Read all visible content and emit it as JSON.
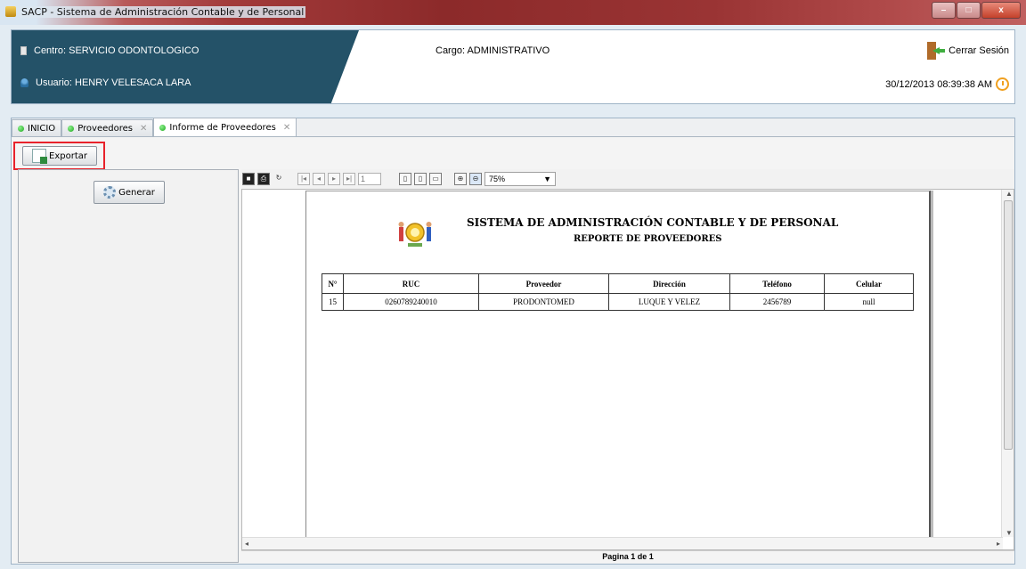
{
  "window": {
    "title": "SACP - Sistema de Administración Contable y de Personal",
    "buttons": {
      "minimize": "–",
      "maximize": "□",
      "close": "x"
    }
  },
  "header": {
    "centro": "Centro: SERVICIO ODONTOLOGICO",
    "usuario": "Usuario: HENRY VELESACA LARA",
    "cargo": "Cargo:  ADMINISTRATIVO",
    "logout_label": "Cerrar Sesión",
    "datetime": "30/12/2013 08:39:38 AM"
  },
  "tabs": [
    {
      "label": "INICIO",
      "closable": false
    },
    {
      "label": "Proveedores",
      "closable": true
    },
    {
      "label": "Informe de Proveedores",
      "closable": true
    }
  ],
  "toolbar": {
    "export_label": "Exportar"
  },
  "left": {
    "generate_label": "Generar"
  },
  "viewer": {
    "page_input": "1",
    "zoom": "75%",
    "page_indicator": "Pagina 1 de 1"
  },
  "report": {
    "title": "SISTEMA DE ADMINISTRACIÓN CONTABLE Y DE PERSONAL",
    "subtitle": "REPORTE DE PROVEEDORES",
    "columns": [
      "N°",
      "RUC",
      "Proveedor",
      "Dirección",
      "Teléfono",
      "Celular"
    ],
    "rows": [
      [
        "15",
        "0260789240010",
        "PRODONTOMED",
        "LUQUE Y VELEZ",
        "2456789",
        "null"
      ]
    ]
  },
  "colors": {
    "header_panel": "#245268",
    "highlight_border": "#e8222b",
    "tab_dot": "#1aa81a"
  }
}
